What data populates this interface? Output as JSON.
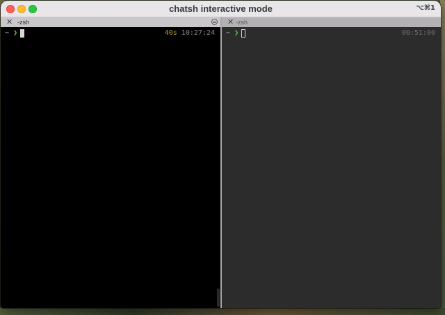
{
  "window": {
    "title": "chatsh interactive mode",
    "shortcut": "⌥⌘1"
  },
  "left_pane": {
    "tab_label": "-zsh",
    "prompt_dir": "~",
    "prompt_symbol": "❯",
    "elapsed": "40s",
    "clock": "10:27:24"
  },
  "right_pane": {
    "tab_label": "-zsh",
    "prompt_dir": "~",
    "prompt_symbol": "❯",
    "clock": "00:51:00"
  },
  "colors": {
    "prompt_arrow": "#5fd14a",
    "elapsed": "#a89a3a",
    "left_bg": "#000000",
    "right_bg": "#2c2c2c"
  }
}
